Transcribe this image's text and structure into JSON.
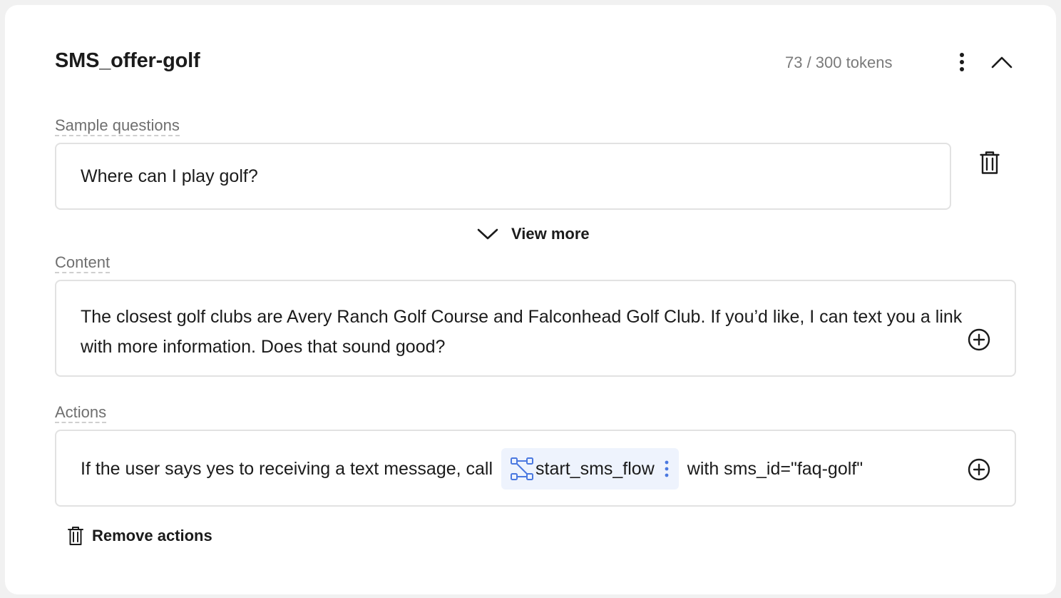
{
  "header": {
    "title": "SMS_offer-golf",
    "token_count": "73 / 300 tokens",
    "more_icon": "vertical-dots-icon",
    "collapse_icon": "chevron-up-icon"
  },
  "sample_questions": {
    "label": "Sample questions",
    "question": "Where can I play golf?",
    "delete_icon": "trash-icon",
    "view_more_label": "View more"
  },
  "content": {
    "label": "Content",
    "text": "The closest golf clubs are Avery Ranch Golf Course and Falconhead Golf Club. If you’d like, I can text you a link with more information. Does that sound good?",
    "add_icon": "plus-circle-icon"
  },
  "actions": {
    "label": "Actions",
    "prefix_text": "If the user says yes to receiving a text message, call",
    "function_chip": {
      "label": "start_sms_flow",
      "icon": "flow-icon",
      "accent_color": "#4a78e0",
      "background": "#eef3fd"
    },
    "suffix_text": "with sms_id=\"faq-golf\"",
    "add_icon": "plus-circle-icon",
    "remove_label": "Remove actions"
  }
}
